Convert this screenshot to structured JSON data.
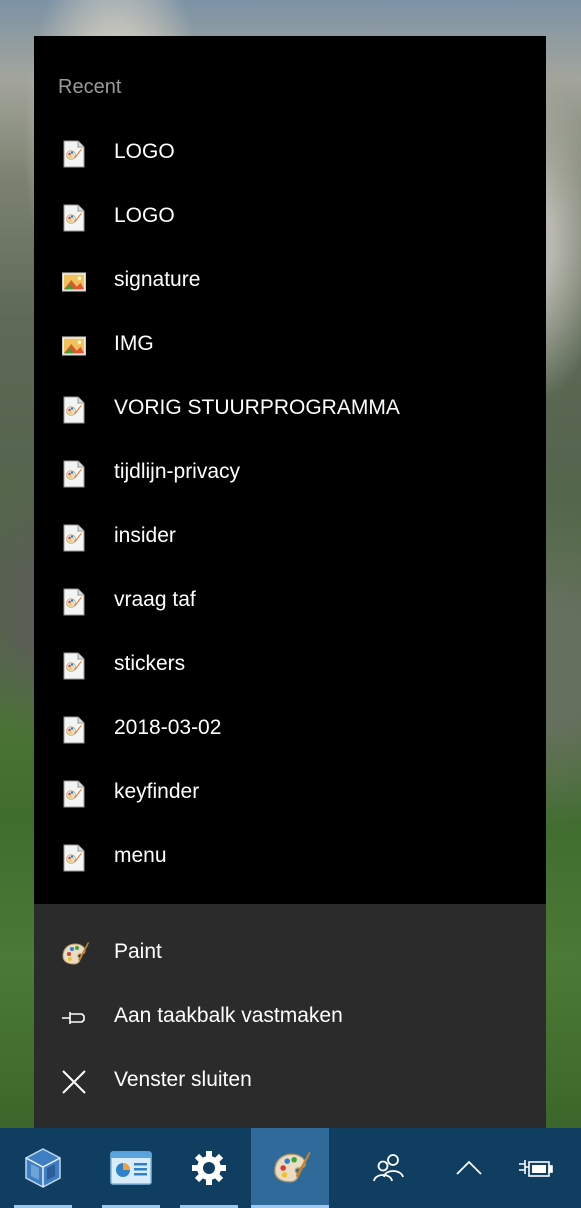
{
  "jumplist": {
    "section_title": "Recent",
    "recent_items": [
      {
        "label": "LOGO",
        "icon": "paint-file-icon"
      },
      {
        "label": "LOGO",
        "icon": "paint-file-icon"
      },
      {
        "label": "signature",
        "icon": "image-file-icon"
      },
      {
        "label": "IMG",
        "icon": "image-file-icon"
      },
      {
        "label": "VORIG STUURPROGRAMMA",
        "icon": "paint-file-icon"
      },
      {
        "label": "tijdlijn-privacy",
        "icon": "paint-file-icon"
      },
      {
        "label": "insider",
        "icon": "paint-file-icon"
      },
      {
        "label": "vraag taf",
        "icon": "paint-file-icon"
      },
      {
        "label": "stickers",
        "icon": "paint-file-icon"
      },
      {
        "label": "2018-03-02",
        "icon": "paint-file-icon"
      },
      {
        "label": "keyfinder",
        "icon": "paint-file-icon"
      },
      {
        "label": "menu",
        "icon": "paint-file-icon"
      }
    ],
    "actions": [
      {
        "label": "Paint",
        "icon": "paint-palette-icon"
      },
      {
        "label": "Aan taakbalk vastmaken",
        "icon": "pin-icon"
      },
      {
        "label": "Venster sluiten",
        "icon": "close-icon"
      }
    ]
  },
  "taskbar": {
    "buttons": [
      {
        "name": "virtualbox",
        "icon": "virtualbox-icon",
        "active": false,
        "running": true
      },
      {
        "name": "presentation",
        "icon": "presentation-icon",
        "active": false,
        "running": true
      },
      {
        "name": "settings",
        "icon": "gear-icon",
        "active": false,
        "running": true
      },
      {
        "name": "paint",
        "icon": "paint-palette-icon",
        "active": true,
        "running": true
      }
    ],
    "tray": [
      "people-icon",
      "chevron-up-icon",
      "power-plug-battery-icon"
    ]
  },
  "colors": {
    "jumplist_bg": "#000000",
    "actions_bg": "#2b2b2b",
    "taskbar_bg": "#0f3e61",
    "taskbar_active": "#2f6a9a",
    "running_indicator": "#9cc8ef",
    "section_title": "#9a9a9a"
  }
}
